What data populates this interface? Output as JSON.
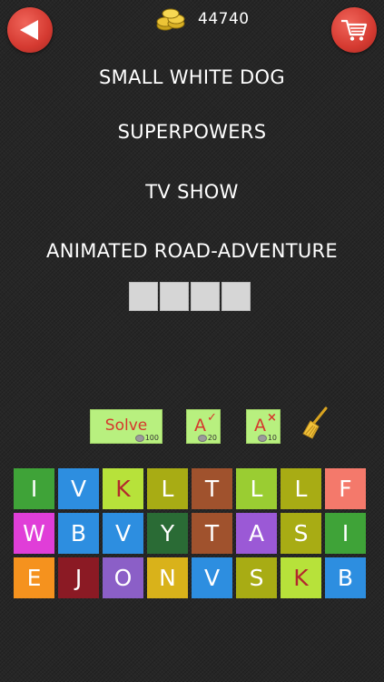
{
  "header": {
    "coin_count": "44740"
  },
  "clues": [
    "SMALL WHITE DOG",
    "SUPERPOWERS",
    "TV SHOW",
    "ANIMATED ROAD-ADVENTURE"
  ],
  "answer": {
    "length": 4
  },
  "actions": {
    "solve_label": "Solve",
    "solve_cost": "100",
    "reveal_label": "A",
    "reveal_cost": "20",
    "remove_label": "A",
    "remove_cost": "10"
  },
  "icons": {
    "back": "back-arrow-icon",
    "cart": "shopping-cart-icon",
    "coins": "coin-stack-icon",
    "reveal": "checkmark-icon",
    "remove": "cross-icon",
    "broom": "broom-icon"
  },
  "letter_tiles": [
    {
      "letter": "I",
      "color": "#3fa338",
      "text_color": "#ffffff"
    },
    {
      "letter": "V",
      "color": "#2d8ee0",
      "text_color": "#ffffff"
    },
    {
      "letter": "K",
      "color": "#b7e23a",
      "text_color": "#b3282d"
    },
    {
      "letter": "L",
      "color": "#a8ac14",
      "text_color": "#ffffff"
    },
    {
      "letter": "T",
      "color": "#a0522d",
      "text_color": "#ffffff"
    },
    {
      "letter": "L",
      "color": "#9acd32",
      "text_color": "#ffffff"
    },
    {
      "letter": "L",
      "color": "#a8ac14",
      "text_color": "#ffffff"
    },
    {
      "letter": "F",
      "color": "#f4796b",
      "text_color": "#ffffff"
    },
    {
      "letter": "W",
      "color": "#e03ed8",
      "text_color": "#ffffff"
    },
    {
      "letter": "B",
      "color": "#2d8ee0",
      "text_color": "#ffffff"
    },
    {
      "letter": "V",
      "color": "#2d8ee0",
      "text_color": "#ffffff"
    },
    {
      "letter": "Y",
      "color": "#2a6b35",
      "text_color": "#ffffff"
    },
    {
      "letter": "T",
      "color": "#a0522d",
      "text_color": "#ffffff"
    },
    {
      "letter": "A",
      "color": "#9b59d6",
      "text_color": "#ffffff"
    },
    {
      "letter": "S",
      "color": "#a8ac14",
      "text_color": "#ffffff"
    },
    {
      "letter": "I",
      "color": "#3fa338",
      "text_color": "#ffffff"
    },
    {
      "letter": "E",
      "color": "#f5921e",
      "text_color": "#ffffff"
    },
    {
      "letter": "J",
      "color": "#8b1a24",
      "text_color": "#ffffff"
    },
    {
      "letter": "O",
      "color": "#8b5fc7",
      "text_color": "#ffffff"
    },
    {
      "letter": "N",
      "color": "#d9b21a",
      "text_color": "#ffffff"
    },
    {
      "letter": "V",
      "color": "#2d8ee0",
      "text_color": "#ffffff"
    },
    {
      "letter": "S",
      "color": "#a8ac14",
      "text_color": "#ffffff"
    },
    {
      "letter": "K",
      "color": "#b7e23a",
      "text_color": "#b3282d"
    },
    {
      "letter": "B",
      "color": "#2d8ee0",
      "text_color": "#ffffff"
    }
  ]
}
